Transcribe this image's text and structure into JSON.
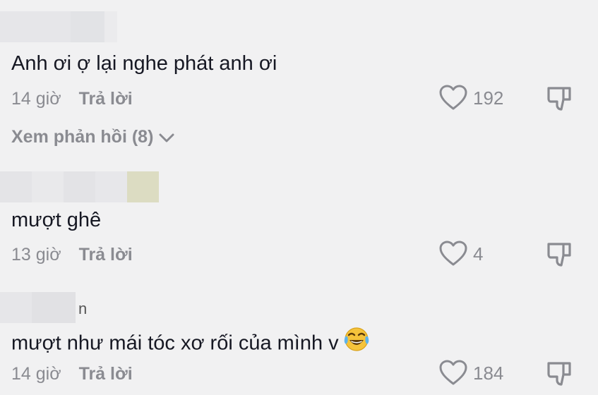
{
  "comments": [
    {
      "username_tail": "",
      "text": "Anh ơi ợ lại nghe phát anh ơi",
      "time": "14 giờ",
      "reply_label": "Trả lời",
      "likes": "192",
      "view_replies": "Xem phản hồi (8)"
    },
    {
      "username_tail": "",
      "text": "mượt ghê",
      "time": "13 giờ",
      "reply_label": "Trả lời",
      "likes": "4"
    },
    {
      "username_tail": "n",
      "text": "mượt như mái tóc xơ rối của mình v",
      "emoji": "face-with-tears-of-joy",
      "time": "14 giờ",
      "reply_label": "Trả lời",
      "likes": "184"
    }
  ],
  "icons": {
    "like": "heart-outline-icon",
    "dislike": "thumbs-down-outline-icon",
    "expand": "chevron-down-icon"
  },
  "colors": {
    "background": "#f1f1f2",
    "text": "#161823",
    "secondary": "#8a8b91"
  }
}
